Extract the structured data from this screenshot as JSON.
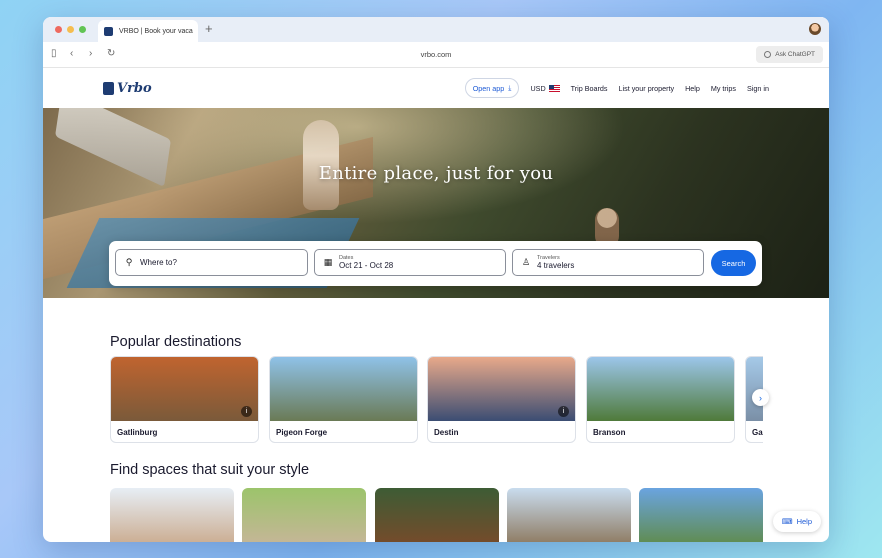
{
  "browser": {
    "tab_title": "VRBO | Book your vaca",
    "new_tab": "+",
    "url": "vrbo.com",
    "ask_chatgpt": "Ask ChatGPT"
  },
  "header": {
    "logo": "Vrbo",
    "open_app": "Open app",
    "currency": "USD",
    "nav": [
      "Trip Boards",
      "List your property",
      "Help",
      "My trips",
      "Sign in"
    ]
  },
  "hero": {
    "title": "Entire place, just for you"
  },
  "search": {
    "where_placeholder": "Where to?",
    "dates_label": "Dates",
    "dates_value": "Oct 21 - Oct 28",
    "travelers_label": "Travelers",
    "travelers_value": "4 travelers",
    "button": "Search"
  },
  "popular": {
    "title": "Popular destinations",
    "destinations": [
      {
        "name": "Gatlinburg",
        "colors": [
          "#c0642f",
          "#7a5a3a"
        ]
      },
      {
        "name": "Pigeon Forge",
        "colors": [
          "#8fc2e8",
          "#6a7a55"
        ]
      },
      {
        "name": "Destin",
        "colors": [
          "#e8a98a",
          "#3b4d73"
        ]
      },
      {
        "name": "Branson",
        "colors": [
          "#9cc6ea",
          "#4f7a3a"
        ]
      },
      {
        "name": "Ga",
        "colors": [
          "#a5c9e8",
          "#7a8fa6"
        ]
      }
    ]
  },
  "styles": {
    "title": "Find spaces that suit your style",
    "tiles": [
      {
        "colors": [
          "#e7eef5",
          "#c9a88a"
        ]
      },
      {
        "colors": [
          "#9cc46b",
          "#c8b59a"
        ]
      },
      {
        "colors": [
          "#3d5c35",
          "#7a4a2a"
        ]
      },
      {
        "colors": [
          "#c9dcee",
          "#8a7458"
        ]
      },
      {
        "colors": [
          "#6aa4e0",
          "#5f8a45"
        ]
      }
    ]
  },
  "help_button": "Help",
  "accent_color": "#1668e3"
}
